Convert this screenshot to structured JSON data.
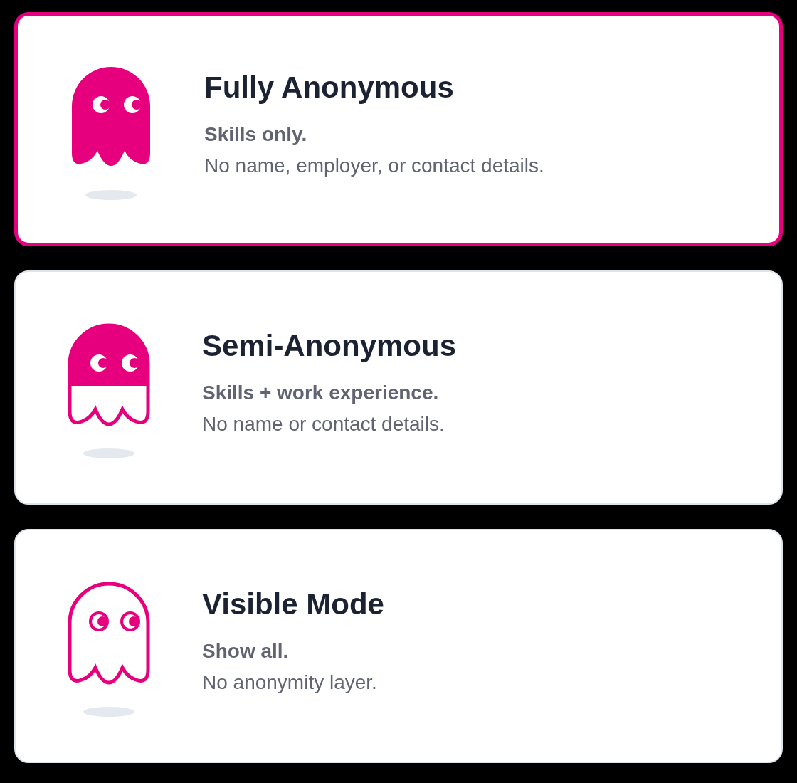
{
  "options": [
    {
      "kind": "full",
      "title": "Fully Anonymous",
      "summary": "Skills only.",
      "detail": "No name, employer, or contact details.",
      "selected": true
    },
    {
      "kind": "half",
      "title": "Semi-Anonymous",
      "summary": "Skills + work experience.",
      "detail": "No name or contact details.",
      "selected": false
    },
    {
      "kind": "outline",
      "title": "Visible Mode",
      "summary": "Show all.",
      "detail": "No anonymity layer.",
      "selected": false
    }
  ]
}
